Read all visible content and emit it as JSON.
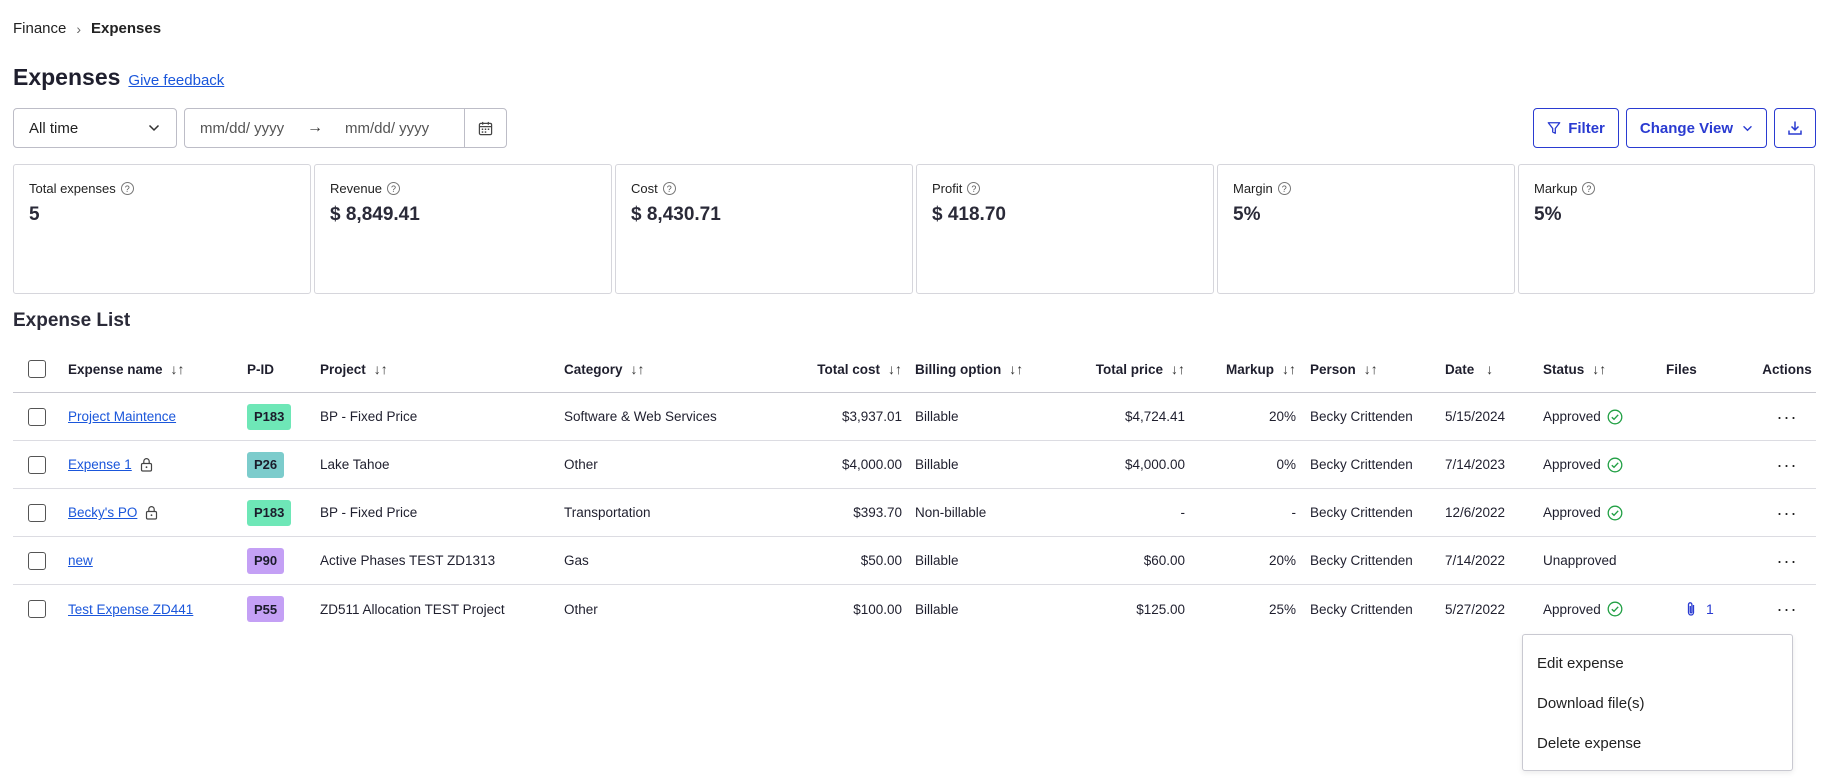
{
  "breadcrumb": {
    "parent": "Finance",
    "separator": "›",
    "current": "Expenses"
  },
  "header": {
    "title": "Expenses",
    "feedback_link": "Give feedback"
  },
  "toolbar": {
    "period": "All time",
    "start_date_placeholder": "mm/dd/ yyyy",
    "arrow": "→",
    "end_date_placeholder": "mm/dd/ yyyy",
    "filter_label": "Filter",
    "change_view_label": "Change View"
  },
  "stats": [
    {
      "label": "Total expenses",
      "value": "5"
    },
    {
      "label": "Revenue",
      "value": "$ 8,849.41"
    },
    {
      "label": "Cost",
      "value": "$ 8,430.71"
    },
    {
      "label": "Profit",
      "value": "$ 418.70"
    },
    {
      "label": "Margin",
      "value": "5%"
    },
    {
      "label": "Markup",
      "value": "5%"
    }
  ],
  "section_title": "Expense List",
  "table": {
    "columns": {
      "name": "Expense name",
      "pid": "P-ID",
      "project": "Project",
      "category": "Category",
      "total_cost": "Total cost",
      "billing": "Billing option",
      "total_price": "Total price",
      "markup": "Markup",
      "person": "Person",
      "date": "Date",
      "status": "Status",
      "files": "Files",
      "actions": "Actions"
    },
    "rows": [
      {
        "name": "Project Maintence",
        "pid": "P183",
        "project": "BP - Fixed Price",
        "category": "Software & Web Services",
        "total_cost": "$3,937.01",
        "billing": "Billable",
        "total_price": "$4,724.41",
        "markup": "20%",
        "person": "Becky Crittenden",
        "date": "5/15/2024",
        "status": "Approved",
        "files": "",
        "actions": "···"
      },
      {
        "name": "Expense 1",
        "pid": "P26",
        "project": "Lake Tahoe",
        "category": "Other",
        "total_cost": "$4,000.00",
        "billing": "Billable",
        "total_price": "$4,000.00",
        "markup": "0%",
        "person": "Becky Crittenden",
        "date": "7/14/2023",
        "status": "Approved",
        "files": "",
        "actions": "···"
      },
      {
        "name": "Becky's PO",
        "pid": "P183",
        "project": "BP - Fixed Price",
        "category": "Transportation",
        "total_cost": "$393.70",
        "billing": "Non-billable",
        "total_price": "-",
        "markup": "-",
        "person": "Becky Crittenden",
        "date": "12/6/2022",
        "status": "Approved",
        "files": "",
        "actions": "···"
      },
      {
        "name": "new",
        "pid": "P90",
        "project": "Active Phases TEST ZD1313",
        "category": "Gas",
        "total_cost": "$50.00",
        "billing": "Billable",
        "total_price": "$60.00",
        "markup": "20%",
        "person": "Becky Crittenden",
        "date": "7/14/2022",
        "status": "Unapproved",
        "files": "",
        "actions": "···"
      },
      {
        "name": "Test Expense ZD441",
        "pid": "P55",
        "project": "ZD511 Allocation TEST Project",
        "category": "Other",
        "total_cost": "$100.00",
        "billing": "Billable",
        "total_price": "$125.00",
        "markup": "25%",
        "person": "Becky Crittenden",
        "date": "5/27/2022",
        "status": "Approved",
        "files": "1",
        "actions": "···"
      }
    ]
  },
  "context_menu": {
    "items": [
      "Edit expense",
      "Download file(s)",
      "Delete expense"
    ]
  },
  "colors": {
    "accent": "#2a3bd1",
    "link": "#1a56db",
    "pill_green": "#6ee7b7",
    "pill_teal": "#7ccccc",
    "pill_purple": "#c4a0f5",
    "approved_icon": "#22a045"
  },
  "icons": {
    "sort": "sort-arrows-icon",
    "sort_desc": "arrow-down-icon",
    "lock": "lock-icon",
    "approved": "check-circle-icon",
    "attachment": "paperclip-icon",
    "calendar": "calendar-icon",
    "filter": "funnel-icon",
    "download": "download-icon",
    "help": "help-circle-icon"
  }
}
